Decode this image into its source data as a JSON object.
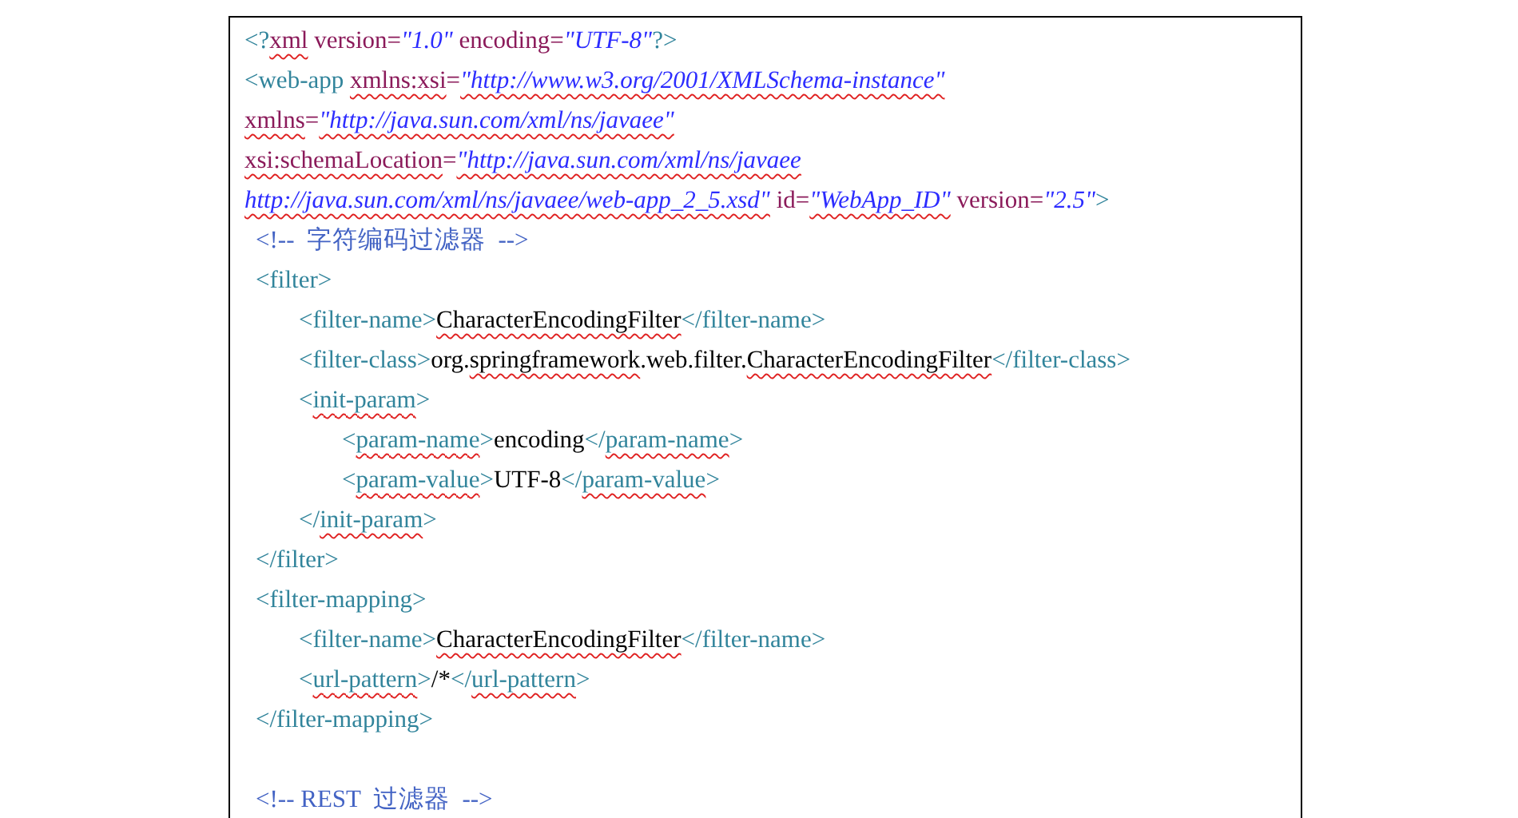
{
  "document": {
    "lines": [
      {
        "kind": "code",
        "segments": [
          {
            "text": "<?",
            "kind": "tag"
          },
          {
            "text": "xml",
            "kind": "attr",
            "spell": true
          },
          {
            "text": " version=",
            "kind": "attr"
          },
          {
            "text": "\"1.0\"",
            "kind": "value"
          },
          {
            "text": " encoding=",
            "kind": "attr"
          },
          {
            "text": "\"UTF-8\"",
            "kind": "value"
          },
          {
            "text": "?>",
            "kind": "tag"
          }
        ]
      },
      {
        "kind": "code",
        "segments": [
          {
            "text": "<web-app ",
            "kind": "tag"
          },
          {
            "text": "xmlns:xsi",
            "kind": "attr",
            "spell": true
          },
          {
            "text": "=",
            "kind": "attr"
          },
          {
            "text": "\"http://www.w3.org/2001/XMLSchema-instance\"",
            "kind": "value",
            "spell": true
          }
        ]
      },
      {
        "kind": "code",
        "segments": [
          {
            "text": "xmlns",
            "kind": "attr",
            "spell": true
          },
          {
            "text": "=",
            "kind": "attr"
          },
          {
            "text": "\"http://java.sun.com/xml/ns/javaee\"",
            "kind": "value",
            "spell": true
          }
        ]
      },
      {
        "kind": "code",
        "segments": [
          {
            "text": "xsi:schemaLocation",
            "kind": "attr",
            "spell": true
          },
          {
            "text": "=",
            "kind": "attr"
          },
          {
            "text": "\"http://java.sun.com/xml/ns/javaee",
            "kind": "value",
            "spell": true
          }
        ]
      },
      {
        "kind": "code",
        "segments": [
          {
            "text": "http://java.sun.com/xml/ns/javaee/web-app_2_5.xsd\"",
            "kind": "value",
            "spell": true
          },
          {
            "text": " id=",
            "kind": "attr"
          },
          {
            "text": "\"WebApp_ID\"",
            "kind": "value",
            "spell": true
          },
          {
            "text": " version=",
            "kind": "attr"
          },
          {
            "text": "\"2.5\"",
            "kind": "value"
          },
          {
            "text": ">",
            "kind": "tag"
          }
        ],
        "children": [
          {
            "kind": "code",
            "segments": [
              {
                "text": "<!--  字符编码过滤器  -->",
                "kind": "comment"
              }
            ]
          },
          {
            "kind": "code",
            "segments": [
              {
                "text": "<filter>",
                "kind": "tag"
              }
            ],
            "children": [
              {
                "kind": "code",
                "segments": [
                  {
                    "text": "<filter-name>",
                    "kind": "tag"
                  },
                  {
                    "text": "CharacterEncodingFilter",
                    "kind": "text",
                    "spell": true
                  },
                  {
                    "text": "</filter-name>",
                    "kind": "tag"
                  }
                ]
              },
              {
                "kind": "code",
                "segments": [
                  {
                    "text": "<filter-class>",
                    "kind": "tag"
                  },
                  {
                    "text": "org.",
                    "kind": "text"
                  },
                  {
                    "text": "springframework",
                    "kind": "text",
                    "spell": true
                  },
                  {
                    "text": ".web.filter.",
                    "kind": "text"
                  },
                  {
                    "text": "CharacterEncodingFilter",
                    "kind": "text",
                    "spell": true
                  },
                  {
                    "text": "</filter-class>",
                    "kind": "tag"
                  }
                ]
              },
              {
                "kind": "code",
                "segments": [
                  {
                    "text": "<",
                    "kind": "tag"
                  },
                  {
                    "text": "init-param",
                    "kind": "tag",
                    "spell": true
                  },
                  {
                    "text": ">",
                    "kind": "tag"
                  }
                ],
                "children": [
                  {
                    "kind": "code",
                    "segments": [
                      {
                        "text": "<",
                        "kind": "tag"
                      },
                      {
                        "text": "param-name",
                        "kind": "tag",
                        "spell": true
                      },
                      {
                        "text": ">",
                        "kind": "tag"
                      },
                      {
                        "text": "encoding",
                        "kind": "text"
                      },
                      {
                        "text": "</",
                        "kind": "tag"
                      },
                      {
                        "text": "param-name",
                        "kind": "tag",
                        "spell": true
                      },
                      {
                        "text": ">",
                        "kind": "tag"
                      }
                    ]
                  },
                  {
                    "kind": "code",
                    "segments": [
                      {
                        "text": "<",
                        "kind": "tag"
                      },
                      {
                        "text": "param-value",
                        "kind": "tag",
                        "spell": true
                      },
                      {
                        "text": ">",
                        "kind": "tag"
                      },
                      {
                        "text": "UTF-8",
                        "kind": "text"
                      },
                      {
                        "text": "</",
                        "kind": "tag"
                      },
                      {
                        "text": "param-value",
                        "kind": "tag",
                        "spell": true
                      },
                      {
                        "text": ">",
                        "kind": "tag"
                      }
                    ]
                  }
                ]
              },
              {
                "kind": "code",
                "segments": [
                  {
                    "text": "</",
                    "kind": "tag"
                  },
                  {
                    "text": "init-param",
                    "kind": "tag",
                    "spell": true
                  },
                  {
                    "text": ">",
                    "kind": "tag"
                  }
                ]
              }
            ]
          },
          {
            "kind": "code",
            "segments": [
              {
                "text": "</filter>",
                "kind": "tag"
              }
            ]
          },
          {
            "kind": "code",
            "segments": [
              {
                "text": "<filter-mapping>",
                "kind": "tag"
              }
            ],
            "children": [
              {
                "kind": "code",
                "segments": [
                  {
                    "text": "<filter-name>",
                    "kind": "tag"
                  },
                  {
                    "text": "CharacterEncodingFilter",
                    "kind": "text",
                    "spell": true
                  },
                  {
                    "text": "</filter-name>",
                    "kind": "tag"
                  }
                ]
              },
              {
                "kind": "code",
                "segments": [
                  {
                    "text": "<",
                    "kind": "tag"
                  },
                  {
                    "text": "url-pattern",
                    "kind": "tag",
                    "spell": true
                  },
                  {
                    "text": ">",
                    "kind": "tag"
                  },
                  {
                    "text": "/*",
                    "kind": "text"
                  },
                  {
                    "text": "</",
                    "kind": "tag"
                  },
                  {
                    "text": "url-pattern",
                    "kind": "tag",
                    "spell": true
                  },
                  {
                    "text": ">",
                    "kind": "tag"
                  }
                ]
              }
            ]
          },
          {
            "kind": "code",
            "segments": [
              {
                "text": "</filter-mapping>",
                "kind": "tag"
              }
            ]
          },
          {
            "kind": "blank"
          },
          {
            "kind": "code",
            "segments": [
              {
                "text": "<!-- REST  过滤器  -->",
                "kind": "comment"
              }
            ]
          }
        ]
      }
    ]
  }
}
